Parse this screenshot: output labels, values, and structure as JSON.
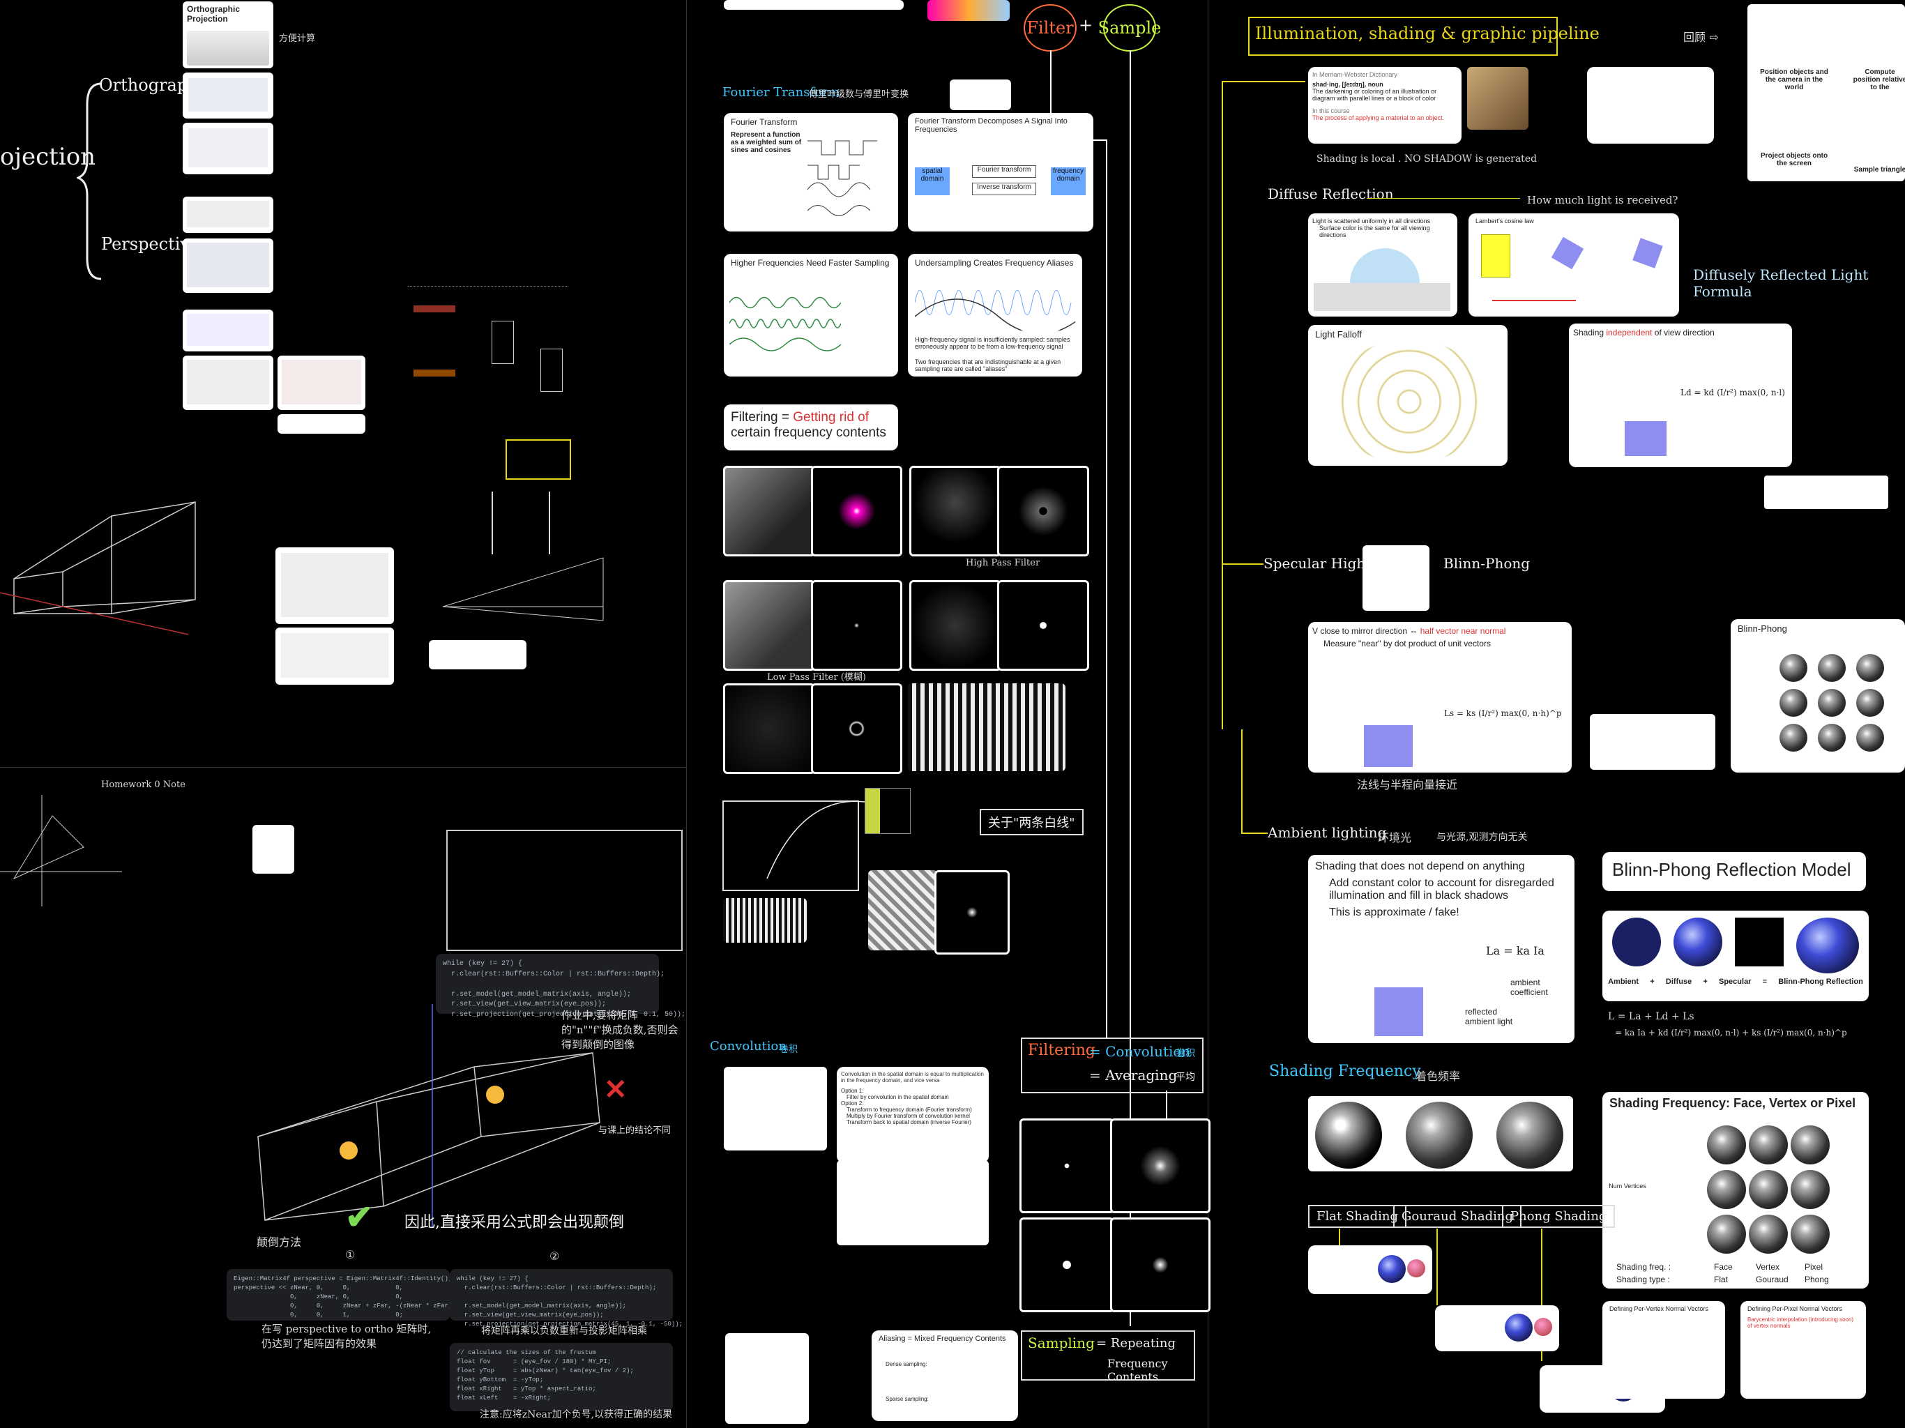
{
  "left_top": {
    "projection": "ojection",
    "orthographic": "Orthographic",
    "perspective": "Perspective",
    "ortho_card_title": "Orthographic Projection",
    "note_side": "方便计算",
    "homework": "Homework 0 Note"
  },
  "left_bottom": {
    "cross_note": "与课上的结论不同",
    "check_note": "因此,直接采用公式即会出现颠倒",
    "note_1": "①",
    "note_2": "②",
    "note_fix": "颠倒方法",
    "note_ortho": "在写 perspective to ortho 矩阵时,\n仍达到了矩阵因有的效果",
    "note_merge": "将矩阵再乘以负数重新与投影矩阵相乘",
    "note_eye": "注意:应将zNear加个负号,以获得正确的结果",
    "note_change": "作业中,要将矩阵的\"n\"\"f\"换成负数,否则会得到颠倒的图像",
    "code1": "while (key != 27) {\n  r.clear(rst::Buffers::Color | rst::Buffers::Depth);\n\n  r.set_model(get_model_matrix(axis, angle));\n  r.set_view(get_view_matrix(eye_pos));\n  r.set_projection(get_projection_matrix(45, 1, 0.1, 50));",
    "code2": "Eigen::Matrix4f perspective = Eigen::Matrix4f::Identity();\nperspective << zNear, 0,     0,            0,\n               0,     zNear, 0,            0,\n               0,     0,     zNear + zFar, -(zNear * zFar),\n               0,     0,     1,            0;",
    "code3": "while (key != 27) {\n  r.clear(rst::Buffers::Color | rst::Buffers::Depth);\n\n  r.set_model(get_model_matrix(axis, angle));\n  r.set_view(get_view_matrix(eye_pos));\n  r.set_projection(get_projection_matrix(45, 1, -0.1, -50));",
    "code4": "// calculate the sizes of the frustum\nfloat fov      = (eye_fov / 180) * MY_PI;\nfloat yTop     = abs(zNear) * tan(eye_fov / 2);\nfloat yBottom  = -yTop;\nfloat xRight   = yTop * aspect_ratio;\nfloat xLeft    = -xRight;"
  },
  "middle": {
    "filter": "Filter",
    "plus": "+",
    "sample": "Sample",
    "fourier": "Fourier Transform",
    "fourier_note": "傅里叶级数与傅里叶变换",
    "ft_card_title": "Fourier Transform",
    "ft_card_text": "Represent a function as a weighted sum of sines and cosines",
    "ftd_title": "Fourier Transform Decomposes A Signal Into Frequencies",
    "spatial_domain": "spatial domain",
    "frequency_domain": "frequency domain",
    "forward": "Fourier transform",
    "inverse": "Inverse transform",
    "hf_title": "Higher Frequencies Need Faster Sampling",
    "us_title": "Undersampling Creates Frequency Aliases",
    "us_text": "High-frequency signal is insufficiently sampled: samples erroneously appear to be from a low-frequency signal",
    "us_text2": "Two frequencies that are indistinguishable at a given sampling rate are called \"aliases\"",
    "filtering_a": "Filtering = ",
    "filtering_b": "Getting rid of",
    "filtering_c": "certain frequency contents",
    "low_pass": "Low Pass Filter (模糊)",
    "high_pass": "High Pass Filter",
    "two_lines": "关于\"两条白线\"",
    "convolution": "Convolution",
    "convolution_note": "卷积",
    "conv_text": "Convolution in the spatial domain is equal to multiplication in the frequency domain, and vice versa",
    "opt1": "Option 1:",
    "opt1a": "Filter by convolution in the spatial domain",
    "opt2": "Option 2:",
    "opt2a": "Transform to frequency domain (Fourier transform)",
    "opt2b": "Multiply by Fourier transform of convolution kernel",
    "opt2c": "Transform back to spatial domain (inverse Fourier)",
    "filt_eq_1": "Filtering",
    "filt_eq_2": "= Convolution",
    "filt_eq_3": "卷积",
    "filt_eq_4": "= Averaging",
    "filt_eq_5": "平均",
    "sampling": "Sampling",
    "samp_eq_1": "= Repeating",
    "samp_eq_2": "Frequency Contents",
    "alias_title": "Aliasing = Mixed Frequency Contents",
    "dense": "Dense sampling:",
    "sparse": "Sparse sampling:"
  },
  "right": {
    "title": "Illumination, shading & graphic pipeline",
    "recap": "回顾 ⇨",
    "dict_head": "In Merriam-Webster Dictionary",
    "dict_word": "shad·ing, [ʃeɪdɪŋ], noun",
    "dict_def": "The darkening or coloring of an illustration or diagram with parallel lines or a block of color",
    "course_head": "In this course",
    "course_def": "The process of applying a material to an object.",
    "local_note": "Shading is local . NO SHADOW is generated",
    "diffuse": "Diffuse Reflection",
    "how_much": "How much light is received?",
    "diff_card": "Light is scattered uniformly in all directions",
    "diff_sub": "Surface color is the same for all viewing directions",
    "lambert": "Lambert's cosine law",
    "falloff": "Light Falloff",
    "indep_a": "Shading ",
    "indep_b": "independent",
    "indep_c": " of view direction",
    "diffuse_formula": "Diffusely Reflected Light Formula",
    "ld_formula": "Ld = kd (I/r²) max(0, n·l)",
    "specular": "Specular Highlights",
    "blinn": "Blinn-Phong",
    "halfvec_a": "V close to mirror direction ⇔ ",
    "halfvec_b": "half vector near normal",
    "halfvec_c": "Measure \"near\" by dot product of unit vectors",
    "ls_formula": "Ls = ks (I/r²) max(0, n·h)^p",
    "spec_note": "法线与半程向量接近",
    "bp_panel": "Blinn-Phong",
    "ambient": "Ambient lighting",
    "ambient_note": "环境光",
    "ambient_note2": "与光源,观测方向无关",
    "amb_title": "Shading that does not depend on anything",
    "amb_b1": "Add constant color to account for disregarded illumination and fill in black shadows",
    "amb_b2": "This is approximate / fake!",
    "la_formula": "La = ka Ia",
    "amb_coef": "ambient coefficient",
    "refl_amb": "reflected ambient light",
    "bpr_title": "Blinn-Phong Reflection Model",
    "bpr_labels": [
      "Ambient",
      "+",
      "Diffuse",
      "+",
      "Specular",
      "=",
      "Blinn-Phong Reflection"
    ],
    "bpr_formula1": "L = La + Ld + Ls",
    "bpr_formula2": "= ka Ia + kd (I/r²) max(0, n·l) + ks (I/r²) max(0, n·h)^p",
    "shading_freq": "Shading Frequency",
    "shading_freq_note": "着色频率",
    "sf_title": "Shading Frequency: Face, Vertex or Pixel",
    "sf_freq": [
      "Face",
      "Vertex",
      "Pixel"
    ],
    "sf_type": [
      "Flat",
      "Gouraud",
      "Phong"
    ],
    "sf_freq_lbl": "Shading freq. :",
    "sf_type_lbl": "Shading type :",
    "num_vertices": "Num Vertices",
    "flat": "Flat Shading",
    "gouraud": "Gouraud Shading",
    "phong": "Phong Shading",
    "pv_title": "Defining Per-Vertex Normal Vectors",
    "pp_title": "Defining Per-Pixel Normal Vectors",
    "pp_sub": "Barycentric interpolation (introducing soon) of vertex normals",
    "pos_cam": "Position objects and the camera in the world",
    "compute": "Compute position relative to the",
    "project": "Project objects onto the screen",
    "sample_tri": "Sample triangle"
  }
}
